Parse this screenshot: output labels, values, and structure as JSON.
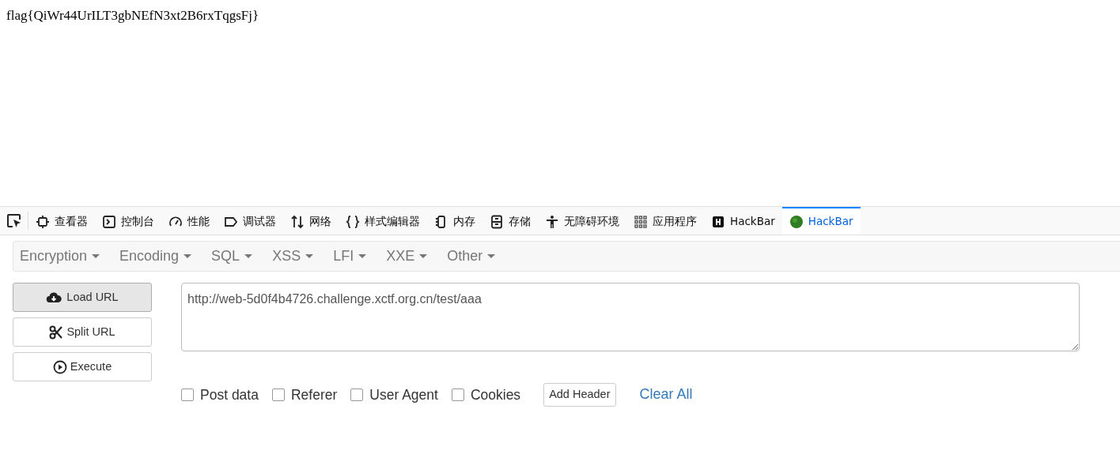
{
  "page": {
    "text": "flag{QiWr44UrILT3gbNEfN3xt2B6rxTqgsFj}"
  },
  "devtools_tabs": [
    {
      "label": "查看器",
      "selected": false
    },
    {
      "label": "控制台",
      "selected": false
    },
    {
      "label": "性能",
      "selected": false
    },
    {
      "label": "调试器",
      "selected": false
    },
    {
      "label": "网络",
      "selected": false
    },
    {
      "label": "样式编辑器",
      "selected": false
    },
    {
      "label": "内存",
      "selected": false
    },
    {
      "label": "存储",
      "selected": false
    },
    {
      "label": "无障碍环境",
      "selected": false
    },
    {
      "label": "应用程序",
      "selected": false
    },
    {
      "label": "HackBar",
      "selected": false
    },
    {
      "label": "HackBar",
      "selected": true
    }
  ],
  "menu": [
    "Encryption",
    "Encoding",
    "SQL",
    "XSS",
    "LFI",
    "XXE",
    "Other"
  ],
  "actions": [
    "Load URL",
    "Split URL",
    "Execute"
  ],
  "url_field": {
    "value": "http://web-5d0f4b4726.challenge.xctf.org.cn/test/aaa"
  },
  "options": [
    {
      "label": "Post data",
      "checked": false
    },
    {
      "label": "Referer",
      "checked": false
    },
    {
      "label": "User Agent",
      "checked": false
    },
    {
      "label": "Cookies",
      "checked": false
    }
  ],
  "add_header": "Add Header",
  "clear_all": "Clear All"
}
